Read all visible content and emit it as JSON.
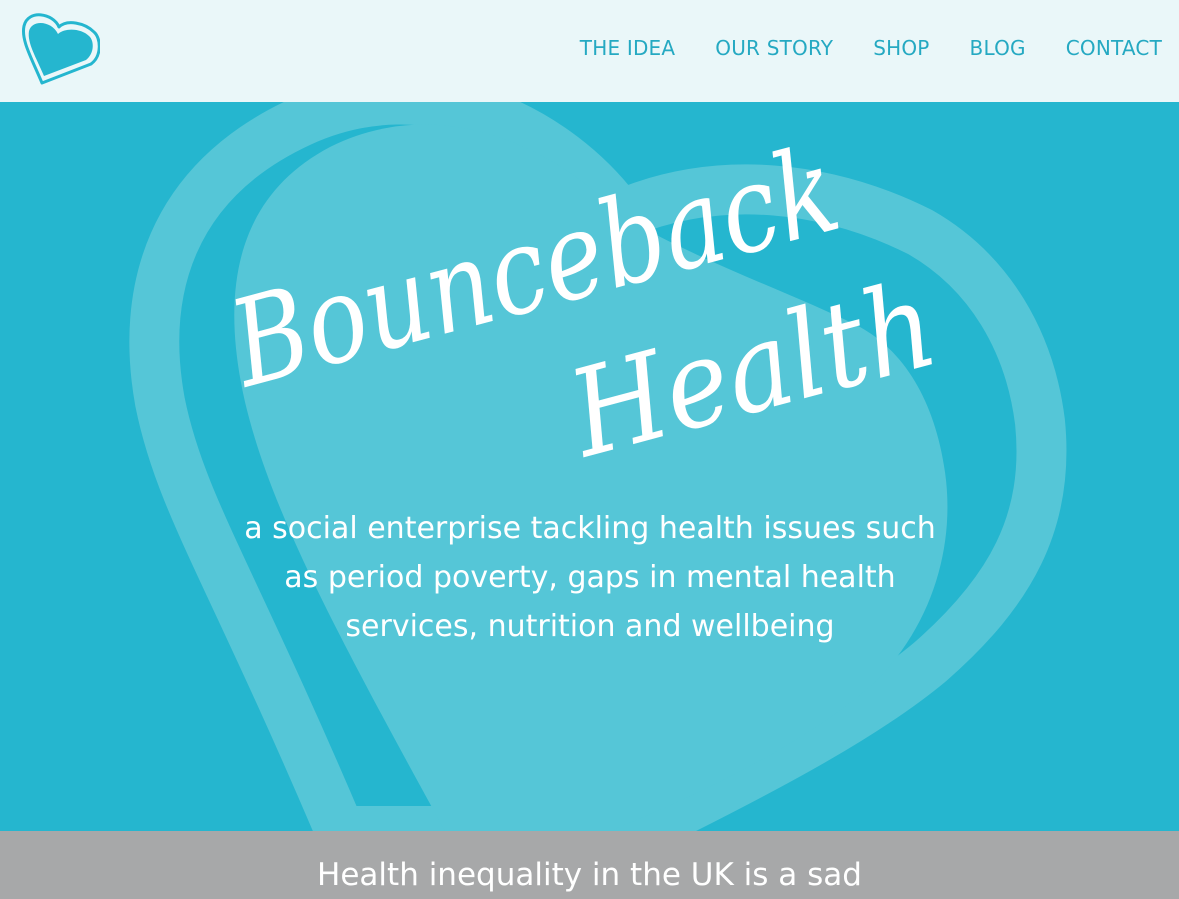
{
  "brand": {
    "name": "Bounceback Health",
    "logo_icon": "heart-icon",
    "accent_color": "#25b6cf",
    "nav_text_color": "#25a9c2"
  },
  "nav": {
    "items": [
      {
        "label": "THE IDEA"
      },
      {
        "label": "OUR STORY"
      },
      {
        "label": "SHOP"
      },
      {
        "label": "BLOG"
      },
      {
        "label": "CONTACT"
      }
    ]
  },
  "hero": {
    "title_line1": "Bounceback",
    "title_line2": "Health",
    "tagline": "a social enterprise tackling health issues such as period poverty, gaps in mental health services, nutrition and wellbeing"
  },
  "intro": {
    "text": "Health inequality in the UK is a sad"
  }
}
